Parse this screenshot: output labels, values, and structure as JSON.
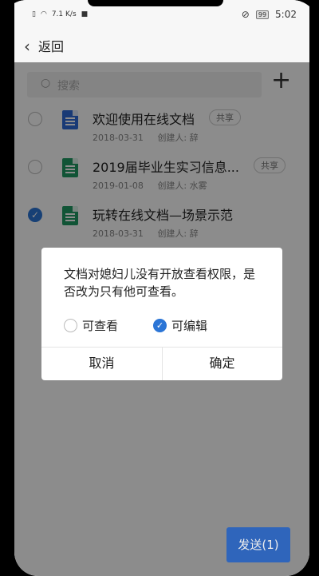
{
  "status_bar": {
    "net_speed": "7.1",
    "net_unit": "K/s",
    "battery": "99",
    "time": "5:02"
  },
  "nav": {
    "back_label": "返回"
  },
  "search": {
    "placeholder": "搜索"
  },
  "documents": [
    {
      "title": "欢迎使用在线文档",
      "date": "2018-03-31",
      "creator": "创建人: 辞",
      "badge": "共享",
      "icon": "doc-icon",
      "checked": false
    },
    {
      "title": "2019届毕业生实习信息...",
      "date": "2019-01-08",
      "creator": "创建人: 水雾",
      "badge": "共享",
      "icon": "sheet-icon",
      "checked": false
    },
    {
      "title": "玩转在线文档—场景示范",
      "date": "2018-03-31",
      "creator": "创建人: 辞",
      "badge": "",
      "icon": "sheet-icon",
      "checked": true
    }
  ],
  "dialog": {
    "message": "文档对媳妇儿没有开放查看权限，是否改为只有他可查看。",
    "option_view": "可查看",
    "option_edit": "可编辑",
    "selected": "edit",
    "cancel": "取消",
    "confirm": "确定"
  },
  "send_button": "发送(1)",
  "colors": {
    "accent": "#2b75d6",
    "send": "#1f5fc4"
  }
}
